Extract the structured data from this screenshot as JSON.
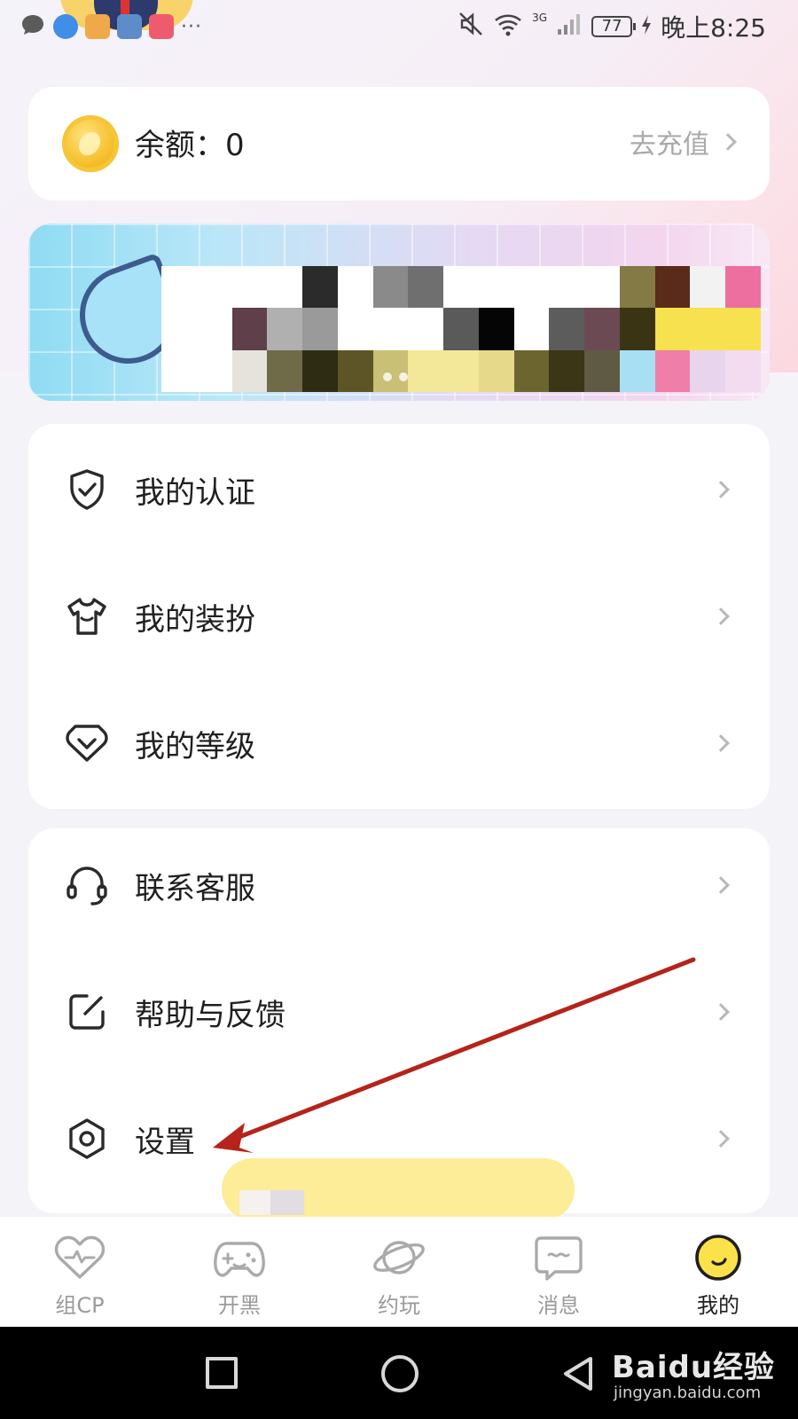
{
  "status_bar": {
    "time": "晚上8:25",
    "battery": "77",
    "network": "3G",
    "more": "···"
  },
  "balance": {
    "label": "余额：0",
    "recharge_label": "去充值"
  },
  "menu_group1": [
    {
      "label": "我的认证",
      "icon": "shield-check-icon"
    },
    {
      "label": "我的装扮",
      "icon": "tshirt-icon"
    },
    {
      "label": "我的等级",
      "icon": "heart-chevron-icon"
    }
  ],
  "menu_group2": [
    {
      "label": "联系客服",
      "icon": "headset-icon"
    },
    {
      "label": "帮助与反馈",
      "icon": "edit-square-icon"
    },
    {
      "label": "设置",
      "icon": "hexagon-settings-icon"
    }
  ],
  "tabs": [
    {
      "label": "组CP",
      "icon": "heart-pulse-icon",
      "active": false
    },
    {
      "label": "开黑",
      "icon": "gamepad-icon",
      "active": false
    },
    {
      "label": "约玩",
      "icon": "planet-icon",
      "active": false
    },
    {
      "label": "消息",
      "icon": "message-icon",
      "active": false
    },
    {
      "label": "我的",
      "icon": "profile-moon-icon",
      "active": true
    }
  ],
  "watermark": {
    "brand": "Baidu经验",
    "url": "jingyan.baidu.com"
  },
  "colors": {
    "accent_yellow": "#fbe14a",
    "annotation_arrow": "#b5231b",
    "inactive_tab": "#9a9a9a",
    "chevron": "#b8b8b8"
  }
}
